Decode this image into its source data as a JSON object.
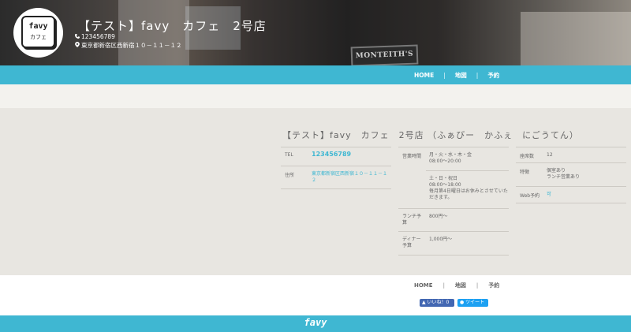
{
  "header": {
    "logo_line1": "favy",
    "logo_line2": "カフェ",
    "shop_title": "【テスト】favy　カフェ　2号店",
    "tel_icon": "phone-icon",
    "tel": "123456789",
    "addr_icon": "map-pin-icon",
    "address": "東京都新宿区西新宿１０－１１－１２",
    "hero_sign_text": "MONTEITH'S"
  },
  "nav": {
    "items": [
      {
        "label": "HOME"
      },
      {
        "label": "地図"
      },
      {
        "label": "予約"
      }
    ],
    "separator": "|"
  },
  "main": {
    "title": "【テスト】favy　カフェ　2号店 （ふぁびー　かふぇ　にごうてん）",
    "col1": [
      {
        "key": "TEL",
        "value": "123456789"
      },
      {
        "key": "住所",
        "value_line1": "東京都新宿区西新宿１０－１１－１",
        "value_line2": "２"
      }
    ],
    "col2": [
      {
        "key": "営業時間",
        "lines": [
          "月・火・水・木・金",
          "08:00～20:00"
        ]
      },
      {
        "key": "",
        "lines": [
          "土・日・祝日",
          "08:00～18:00",
          "毎月第4日曜日はお休みとさせていた",
          "だきます。"
        ]
      },
      {
        "key_line1": "ランチ予",
        "key_line2": "算",
        "value": "800円～"
      },
      {
        "key_line1": "ディナー",
        "key_line2": "予算",
        "value": "1,000円～"
      }
    ],
    "col3": [
      {
        "key": "座席数",
        "value": "12"
      },
      {
        "key": "特徴",
        "lines": [
          "個室あり",
          "ランチ営業あり"
        ]
      },
      {
        "key": "Web予約",
        "value": "可"
      }
    ]
  },
  "footer": {
    "nav": [
      {
        "label": "HOME"
      },
      {
        "label": "地図"
      },
      {
        "label": "予約"
      }
    ],
    "like_button": "いいね！0",
    "tweet_button": "ツイート",
    "brand": "favy"
  },
  "colors": {
    "accent": "#3fb7d2",
    "background": "#e8e6e1",
    "facebook": "#4267b2",
    "twitter": "#1da1f2"
  }
}
